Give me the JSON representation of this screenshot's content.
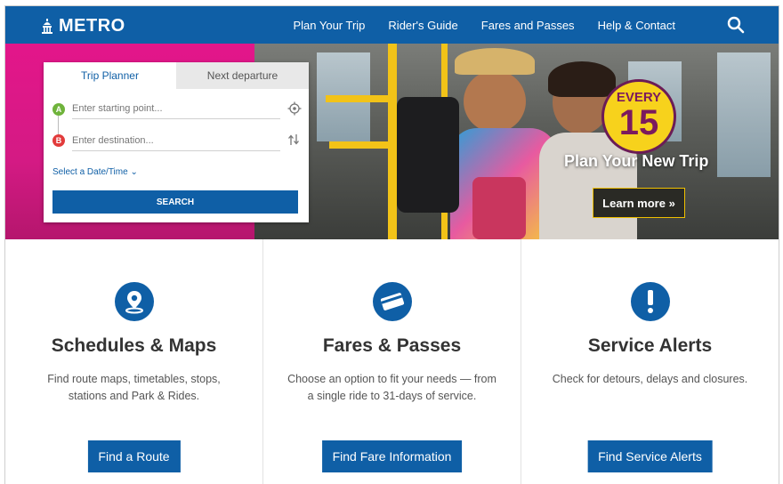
{
  "header": {
    "logo_text": "METRO",
    "nav": [
      "Plan Your Trip",
      "Rider's Guide",
      "Fares and Passes",
      "Help & Contact"
    ],
    "search_icon": "search-icon"
  },
  "planner": {
    "tabs": [
      "Trip Planner",
      "Next departure"
    ],
    "start_marker": "A",
    "dest_marker": "B",
    "start_placeholder": "Enter starting point...",
    "dest_placeholder": "Enter destination...",
    "date_link": "Select a Date/Time ⌄",
    "search_label": "SEARCH"
  },
  "hero": {
    "badge_top": "EVERY",
    "badge_number": "15",
    "title": "Plan Your New Trip",
    "button": "Learn more »",
    "colors": {
      "pink": "#e3168a",
      "yellow": "#f7d21c"
    }
  },
  "sections": [
    {
      "icon": "map-pin-icon",
      "title": "Schedules & Maps",
      "description": "Find route maps, timetables, stops, stations and Park & Rides.",
      "button": "Find a Route"
    },
    {
      "icon": "fare-card-icon",
      "title": "Fares & Passes",
      "description": "Choose an option to fit your needs — from a single ride to 31-days of service.",
      "button": "Find Fare Information"
    },
    {
      "icon": "alert-icon",
      "title": "Service Alerts",
      "description": "Check for detours, delays and closures.",
      "button": "Find Service Alerts"
    }
  ],
  "brand_color": "#0f5fa6"
}
